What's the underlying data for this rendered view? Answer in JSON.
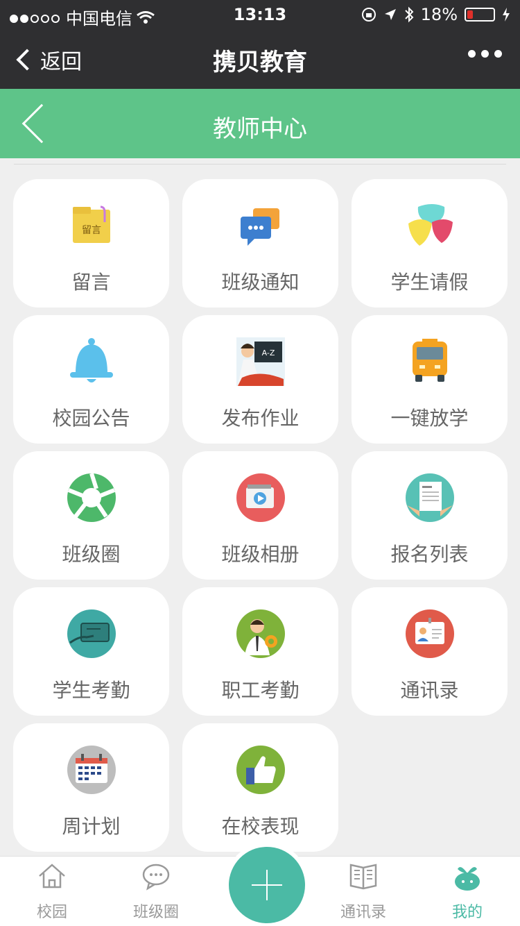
{
  "status_bar": {
    "carrier": "中国电信",
    "time": "13:13",
    "battery": "18%"
  },
  "nav": {
    "back_label": "返回",
    "title": "携贝教育"
  },
  "header": {
    "title": "教师中心"
  },
  "grid": [
    {
      "label": "留言",
      "icon": "message-folder-icon"
    },
    {
      "label": "班级通知",
      "icon": "chat-bubble-icon"
    },
    {
      "label": "学生请假",
      "icon": "colorful-shapes-icon"
    },
    {
      "label": "校园公告",
      "icon": "bell-icon"
    },
    {
      "label": "发布作业",
      "icon": "teacher-board-icon"
    },
    {
      "label": "一键放学",
      "icon": "school-bus-icon"
    },
    {
      "label": "班级圈",
      "icon": "aperture-icon"
    },
    {
      "label": "班级相册",
      "icon": "video-album-icon"
    },
    {
      "label": "报名列表",
      "icon": "signup-list-icon"
    },
    {
      "label": "学生考勤",
      "icon": "card-attendance-icon"
    },
    {
      "label": "职工考勤",
      "icon": "staff-gear-icon"
    },
    {
      "label": "通讯录",
      "icon": "id-card-icon"
    },
    {
      "label": "周计划",
      "icon": "calendar-icon"
    },
    {
      "label": "在校表现",
      "icon": "thumbs-up-icon"
    }
  ],
  "tabs": [
    {
      "label": "校园",
      "icon": "house-icon"
    },
    {
      "label": "班级圈",
      "icon": "chat-icon"
    },
    {
      "label": "通讯录",
      "icon": "book-icon"
    },
    {
      "label": "我的",
      "icon": "sprout-icon"
    }
  ],
  "colors": {
    "green_header": "#5ec489",
    "accent": "#4bbaa5",
    "dark_bar": "#2f2f31"
  }
}
